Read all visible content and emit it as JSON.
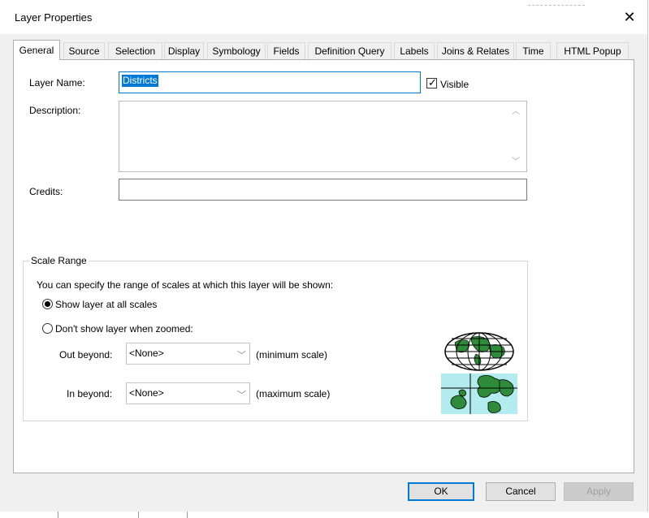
{
  "window": {
    "title": "Layer Properties",
    "close_glyph": "✕"
  },
  "tabs": [
    {
      "label": "General",
      "active": true
    },
    {
      "label": "Source"
    },
    {
      "label": "Selection"
    },
    {
      "label": "Display"
    },
    {
      "label": "Symbology"
    },
    {
      "label": "Fields"
    },
    {
      "label": "Definition Query"
    },
    {
      "label": "Labels"
    },
    {
      "label": "Joins & Relates"
    },
    {
      "label": "Time"
    },
    {
      "label": "HTML Popup"
    }
  ],
  "general": {
    "layer_name_label": "Layer Name:",
    "layer_name_value": "Districts",
    "visible_label": "Visible",
    "visible_checked": true,
    "description_label": "Description:",
    "description_value": "",
    "credits_label": "Credits:",
    "credits_value": ""
  },
  "scale_range": {
    "title": "Scale Range",
    "intro": "You can specify the range of scales at which this layer will be shown:",
    "option_all": "Show layer at all scales",
    "option_zoomed": "Don't show layer when zoomed:",
    "selected_option": "all",
    "out_beyond_label": "Out beyond:",
    "out_beyond_value": "<None>",
    "min_scale_label": "(minimum scale)",
    "in_beyond_label": "In beyond:",
    "in_beyond_value": "<None>",
    "max_scale_label": "(maximum scale)",
    "globe_icon": "globe-icon",
    "map_icon": "zoomed-map-icon"
  },
  "buttons": {
    "ok": "OK",
    "cancel": "Cancel",
    "apply": "Apply"
  },
  "colors": {
    "accent": "#0078d7",
    "map_green": "#2e7d32",
    "map_water": "#b3ecef"
  }
}
